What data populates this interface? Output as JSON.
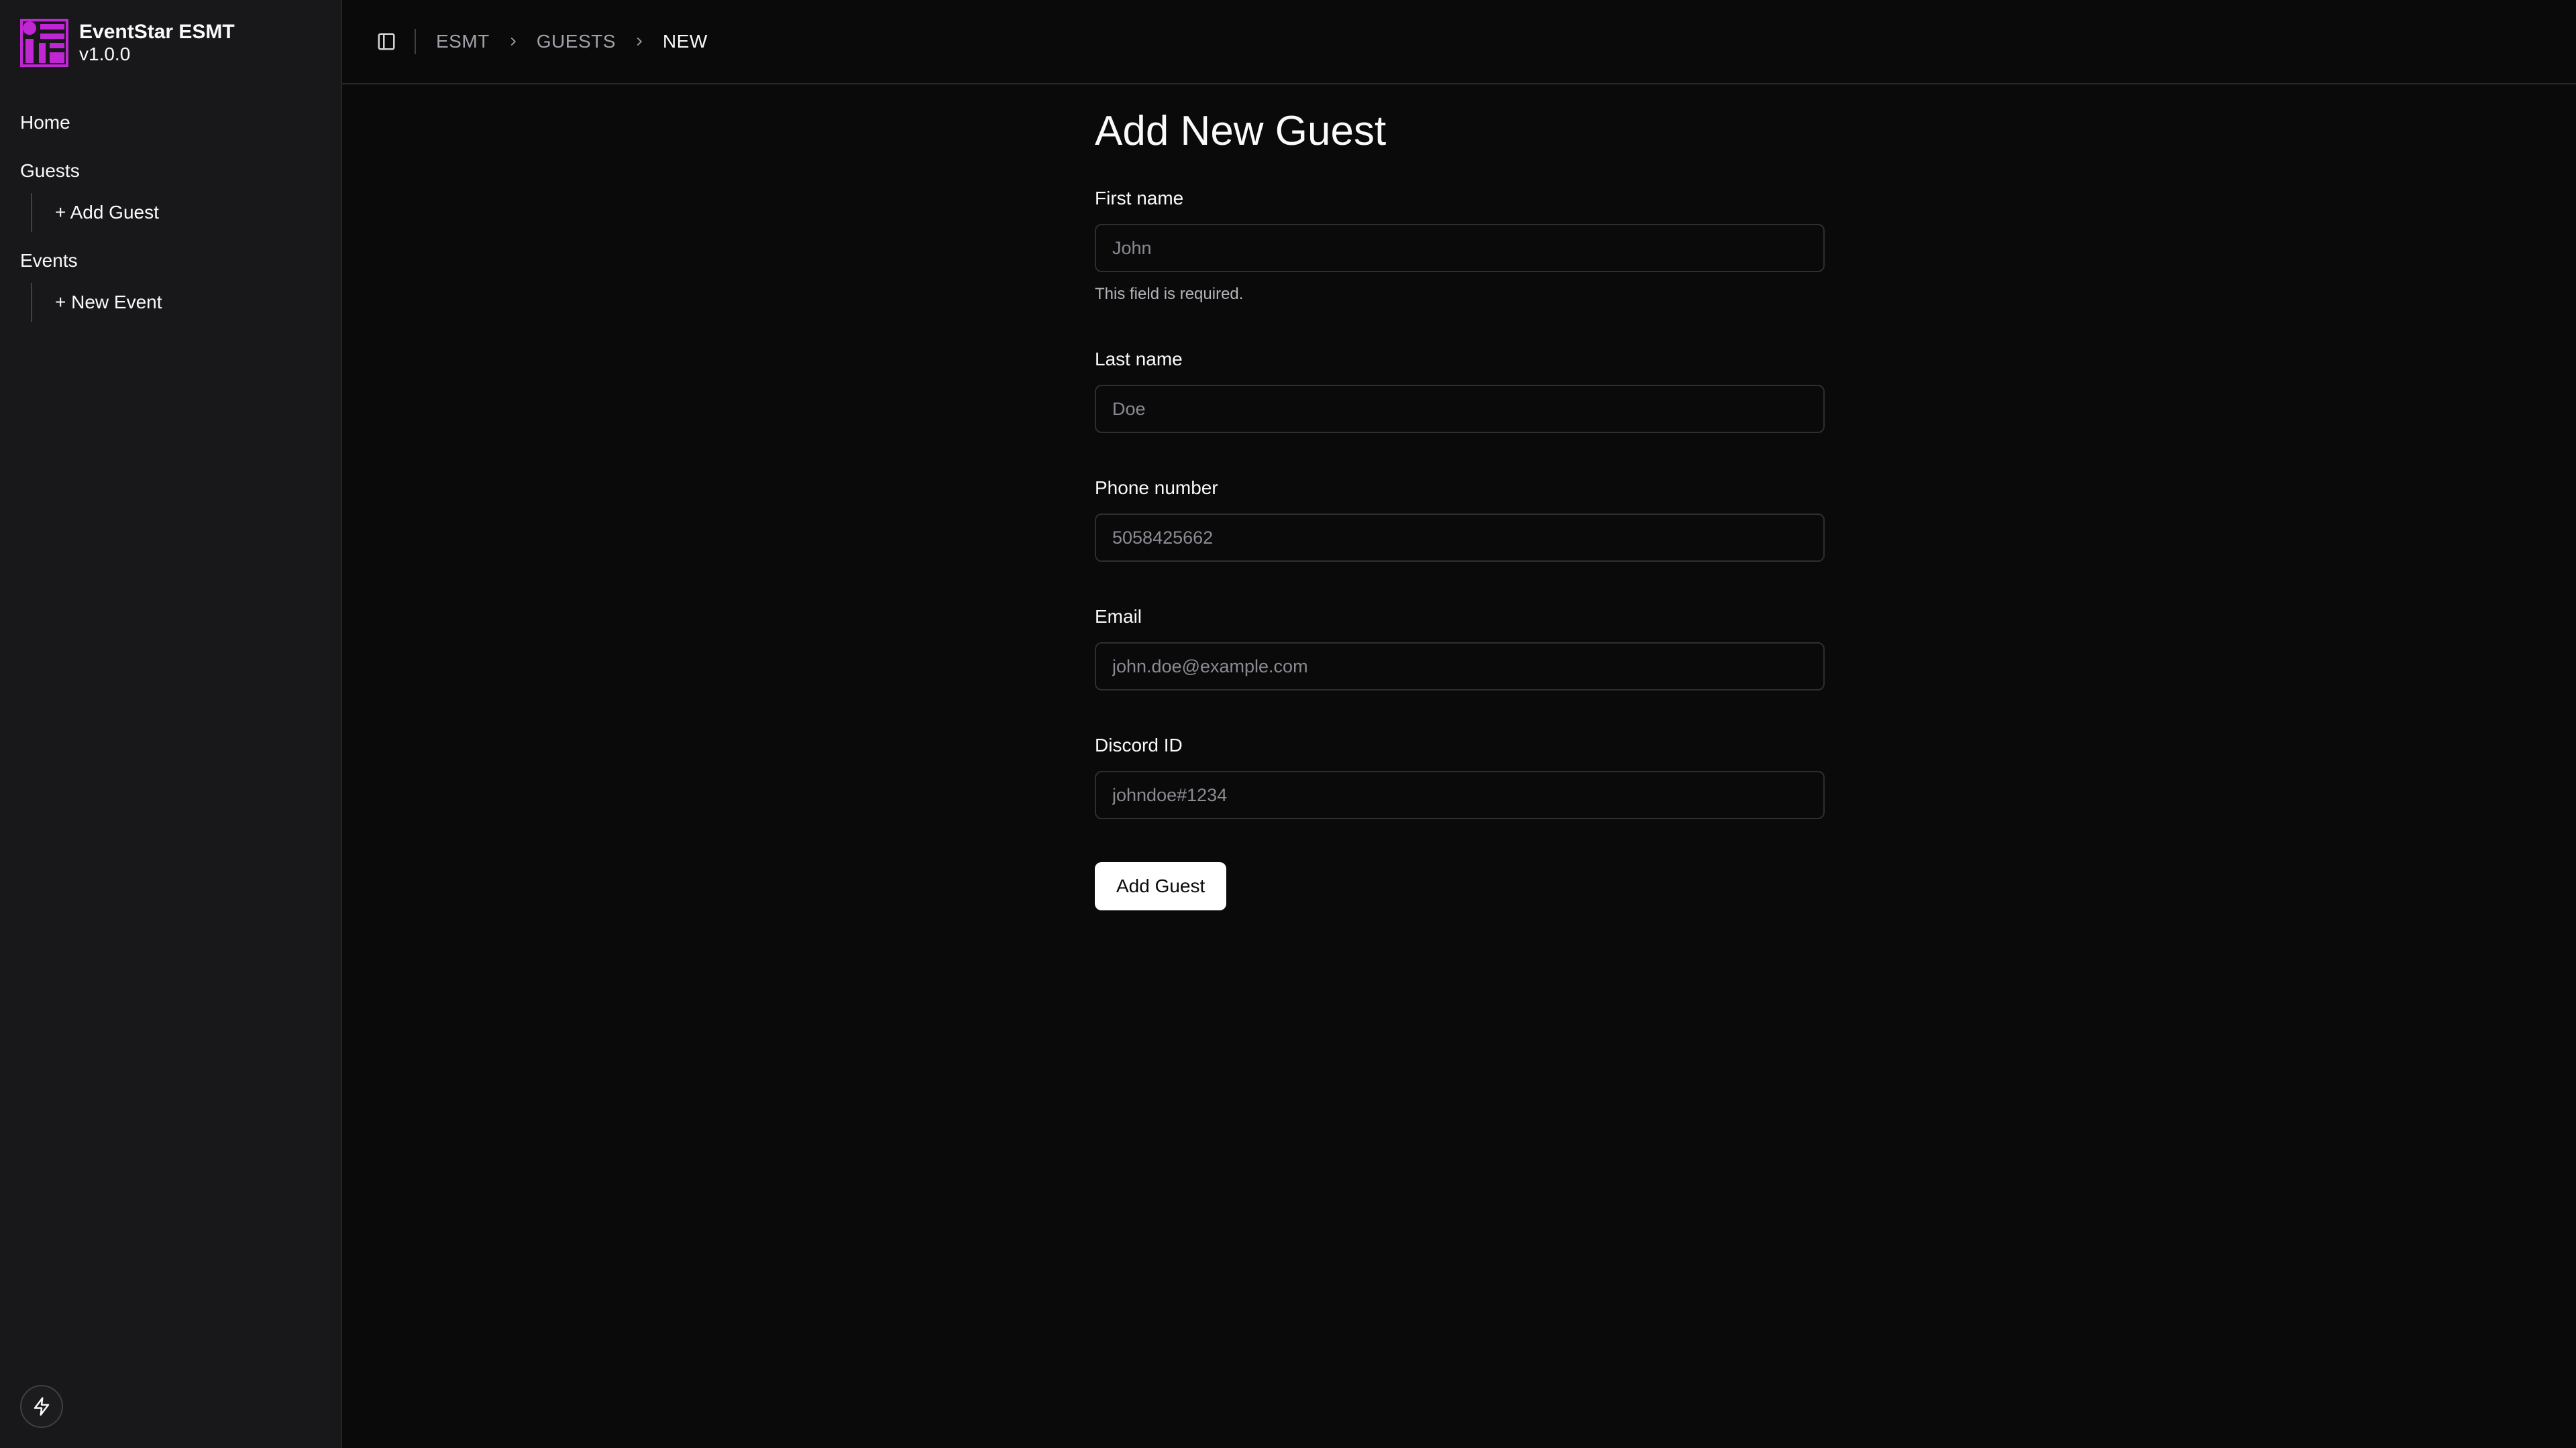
{
  "brand": {
    "name": "EventStar ESMT",
    "version": "v1.0.0",
    "accent": "#c026d3"
  },
  "sidebar": {
    "home": "Home",
    "guests": {
      "label": "Guests",
      "add": "+ Add Guest"
    },
    "events": {
      "label": "Events",
      "add": "+ New Event"
    },
    "bottom_icon": "bolt-icon"
  },
  "topbar": {
    "toggle_icon": "sidebar-toggle-icon",
    "breadcrumb": [
      "ESMT",
      "GUESTS",
      "NEW"
    ]
  },
  "form": {
    "title": "Add New Guest",
    "fields": {
      "first_name": {
        "label": "First name",
        "placeholder": "John",
        "value": "",
        "error": "This field is required."
      },
      "last_name": {
        "label": "Last name",
        "placeholder": "Doe",
        "value": ""
      },
      "phone": {
        "label": "Phone number",
        "placeholder": "5058425662",
        "value": ""
      },
      "email": {
        "label": "Email",
        "placeholder": "john.doe@example.com",
        "value": ""
      },
      "discord": {
        "label": "Discord ID",
        "placeholder": "johndoe#1234",
        "value": ""
      }
    },
    "submit_label": "Add Guest"
  }
}
